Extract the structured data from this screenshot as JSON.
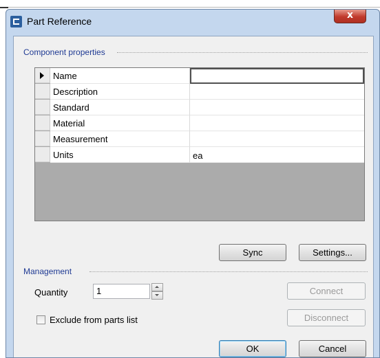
{
  "window": {
    "title": "Part Reference",
    "close_glyph": "x",
    "icon": "app-icon"
  },
  "component_properties": {
    "group_label": "Component properties",
    "rows": [
      {
        "name": "Name",
        "value": "",
        "active": true
      },
      {
        "name": "Description",
        "value": ""
      },
      {
        "name": "Standard",
        "value": ""
      },
      {
        "name": "Material",
        "value": ""
      },
      {
        "name": "Measurement",
        "value": ""
      },
      {
        "name": "Units",
        "value": "ea"
      }
    ],
    "sync_label": "Sync",
    "settings_label": "Settings..."
  },
  "management": {
    "group_label": "Management",
    "quantity_label": "Quantity",
    "quantity_value": "1",
    "connect_label": "Connect",
    "disconnect_label": "Disconnect",
    "exclude_label": "Exclude from parts list",
    "exclude_checked": false
  },
  "footer": {
    "ok_label": "OK",
    "cancel_label": "Cancel"
  }
}
